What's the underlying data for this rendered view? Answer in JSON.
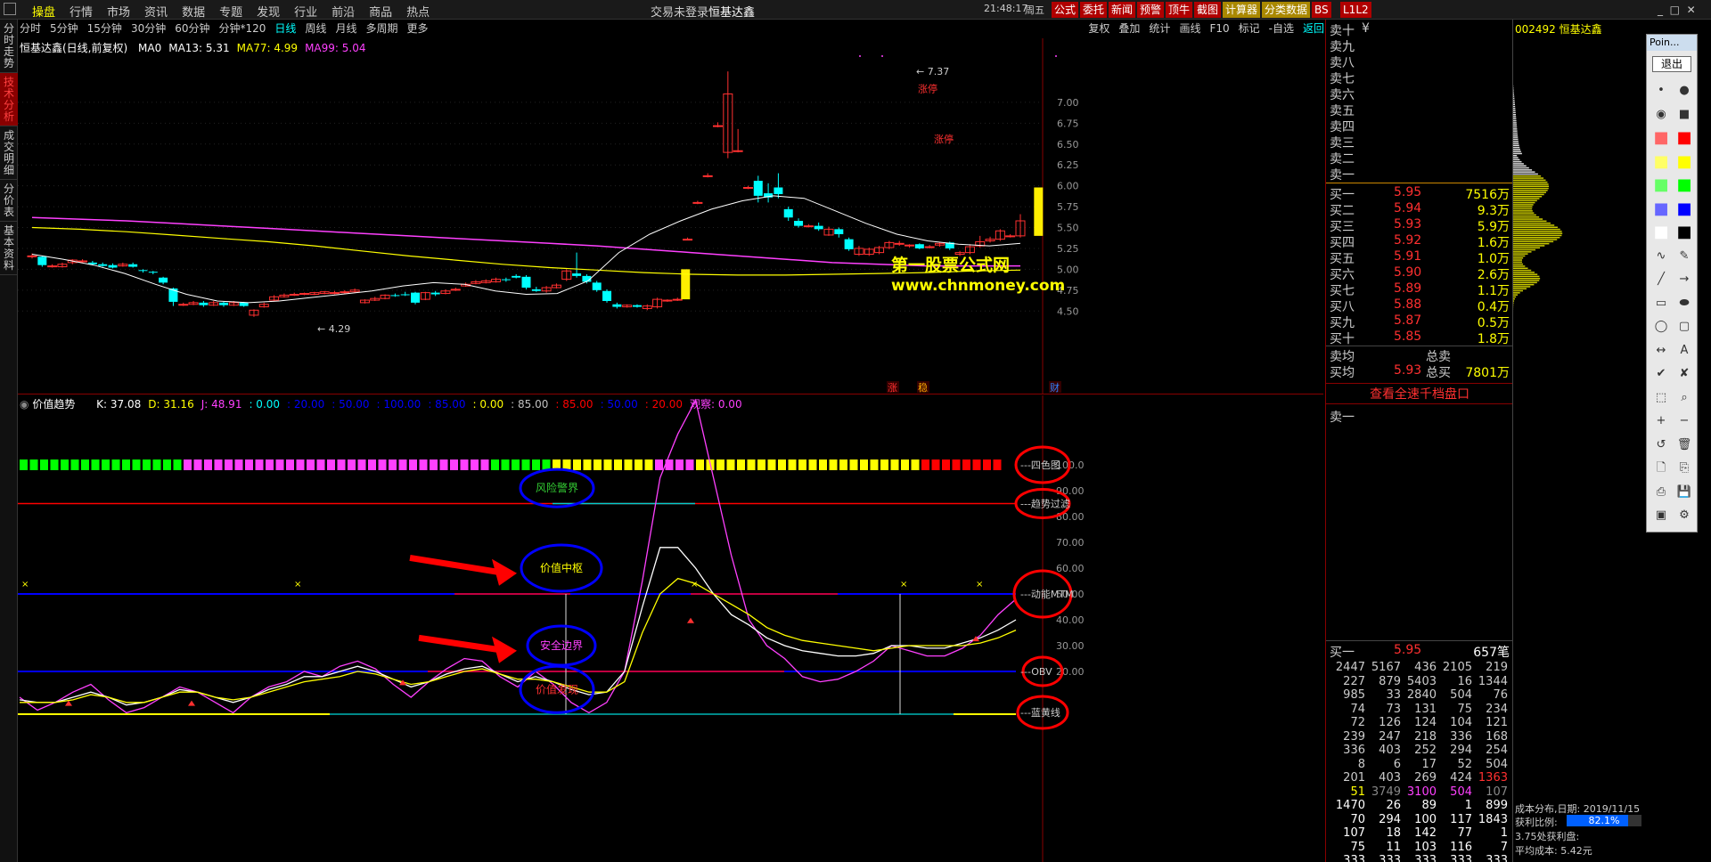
{
  "topbar": {
    "menu": [
      "操盘",
      "行情",
      "市场",
      "资讯",
      "数据",
      "专题",
      "发现",
      "行业",
      "前沿",
      "商品",
      "热点"
    ],
    "active": "操盘",
    "login_status": "交易未登录",
    "stock_name": "恒基达鑫",
    "time": "21:48:17",
    "weekday": "周五",
    "buttons": [
      "公式",
      "委托",
      "新闻",
      "预警",
      "顶牛",
      "截图",
      "计算器",
      "分类数据",
      "BS",
      "L1L2"
    ]
  },
  "periods": [
    "分时",
    "5分钟",
    "15分钟",
    "30分钟",
    "60分钟",
    "分钟*120",
    "日线",
    "周线",
    "月线",
    "多周期",
    "更多"
  ],
  "period_active": "日线",
  "right_tools": [
    "复权",
    "叠加",
    "统计",
    "画线",
    "F10",
    "标记",
    "-自选",
    "返回"
  ],
  "left_tabs": [
    "分时走势",
    "技术分析",
    "成交明细",
    "分价表",
    "基本资料"
  ],
  "main": {
    "title": "恒基达鑫(日线,前复权)",
    "ma_labels": [
      {
        "t": "MA0",
        "c": "#ffffff"
      },
      {
        "t": "MA13: 5.31",
        "c": "#ffffff"
      },
      {
        "t": "MA77: 4.99",
        "c": "#ffff00"
      },
      {
        "t": "MA99: 5.04",
        "c": "#ff40ff"
      }
    ],
    "y_ticks": [
      "7.00",
      "6.75",
      "6.50",
      "6.25",
      "6.00",
      "5.75",
      "5.50",
      "5.25",
      "5.00",
      "4.75",
      "4.50"
    ],
    "high_label": "7.37",
    "low_label": "4.29",
    "limit_up": "涨停",
    "watermark1": "第一股票公式网",
    "watermark2": "www.chnmoney.com",
    "markers": [
      "涨",
      "稳",
      "财"
    ]
  },
  "sub": {
    "title": "价值趋势",
    "params": [
      {
        "t": "K: 37.08",
        "c": "#ffffff"
      },
      {
        "t": "D: 31.16",
        "c": "#ffff00"
      },
      {
        "t": "J: 48.91",
        "c": "#ff40ff"
      },
      {
        "t": ": 0.00",
        "c": "#00ffff"
      },
      {
        "t": ": 20.00",
        "c": "#0000ff"
      },
      {
        "t": ": 50.00",
        "c": "#0000ff"
      },
      {
        "t": ": 100.00",
        "c": "#0000ff"
      },
      {
        "t": ": 85.00",
        "c": "#0000ff"
      },
      {
        "t": ": 0.00",
        "c": "#ffff00"
      },
      {
        "t": ": 85.00",
        "c": "#c0c0c0"
      },
      {
        "t": ": 85.00",
        "c": "#ff0000"
      },
      {
        "t": ": 50.00",
        "c": "#0000ff"
      },
      {
        "t": ": 20.00",
        "c": "#ff0000"
      },
      {
        "t": "观察: 0.00",
        "c": "#ff40ff"
      }
    ],
    "y_ticks": [
      "100.0",
      "90.00",
      "80.00",
      "70.00",
      "60.00",
      "50.00",
      "40.00",
      "30.00",
      "20.00"
    ],
    "annotations": [
      "风险警界",
      "价值中枢",
      "安全边界",
      "价值发现"
    ],
    "right_labels": [
      "四色图",
      "趋势过滤",
      "动能MTM",
      "OBV",
      "蓝黄线"
    ]
  },
  "orderbook": {
    "sell_labels": [
      "卖十",
      "卖九",
      "卖八",
      "卖七",
      "卖六",
      "卖五",
      "卖四",
      "卖三",
      "卖二",
      "卖一"
    ],
    "sell_ten_extra": "¥",
    "buy": [
      {
        "l": "买一",
        "p": "5.95",
        "v": "7516万"
      },
      {
        "l": "买二",
        "p": "5.94",
        "v": "9.3万"
      },
      {
        "l": "买三",
        "p": "5.93",
        "v": "5.9万"
      },
      {
        "l": "买四",
        "p": "5.92",
        "v": "1.6万"
      },
      {
        "l": "买五",
        "p": "5.91",
        "v": "1.0万"
      },
      {
        "l": "买六",
        "p": "5.90",
        "v": "2.6万"
      },
      {
        "l": "买七",
        "p": "5.89",
        "v": "1.1万"
      },
      {
        "l": "买八",
        "p": "5.88",
        "v": "0.4万"
      },
      {
        "l": "买九",
        "p": "5.87",
        "v": "0.5万"
      },
      {
        "l": "买十",
        "p": "5.85",
        "v": "1.8万"
      }
    ],
    "sell_avg_label": "卖均",
    "sell_total_label": "总卖",
    "buy_avg_label": "买均",
    "buy_avg": "5.93",
    "buy_total_label": "总买",
    "buy_total": "7801万",
    "view_all": "查看全速千档盘口",
    "queue_sell_label": "卖一",
    "queue_buy_label": "买一",
    "queue_buy_price": "5.95",
    "queue_buy_count": "657笔",
    "ticks": [
      [
        "2447",
        "5167",
        "436",
        "2105",
        "219"
      ],
      [
        "227",
        "879",
        "5403",
        "16",
        "1344"
      ],
      [
        "985",
        "33",
        "2840",
        "504",
        "76"
      ],
      [
        "74",
        "73",
        "131",
        "75",
        "234"
      ],
      [
        "72",
        "126",
        "124",
        "104",
        "121"
      ],
      [
        "239",
        "247",
        "218",
        "336",
        "168"
      ],
      [
        "336",
        "403",
        "252",
        "294",
        "254"
      ],
      [
        "8",
        "6",
        "17",
        "52",
        "504"
      ],
      [
        "201",
        "403",
        "269",
        "424",
        "1363"
      ],
      [
        "51",
        "3749",
        "3100",
        "504",
        "107"
      ],
      [
        "1470",
        "26",
        "89",
        "1",
        "899"
      ],
      [
        "70",
        "294",
        "100",
        "117",
        "1843"
      ],
      [
        "107",
        "18",
        "142",
        "77",
        "1"
      ],
      [
        "75",
        "11",
        "103",
        "116",
        "7"
      ],
      [
        "333",
        "333",
        "333",
        "333",
        "333"
      ]
    ]
  },
  "cost": {
    "code": "002492",
    "name": "恒基达鑫",
    "dist_label": "成本分布,日期:",
    "date": "2019/11/15",
    "profit_label": "获利比例:",
    "profit_ratio": 0.821,
    "profit_ratio_text": "82.1%",
    "profit_price_text": "3.75处获利盘:",
    "avg_cost_label": "平均成本:",
    "avg_cost": "5.42元"
  },
  "palette": {
    "title": "Poin...",
    "exit": "退出"
  },
  "colors": {
    "up": "#ff3030",
    "down": "#00ffff",
    "bg": "#000000",
    "ma13": "#ffffff",
    "ma77": "#ffff00",
    "ma99": "#ff40ff"
  }
}
